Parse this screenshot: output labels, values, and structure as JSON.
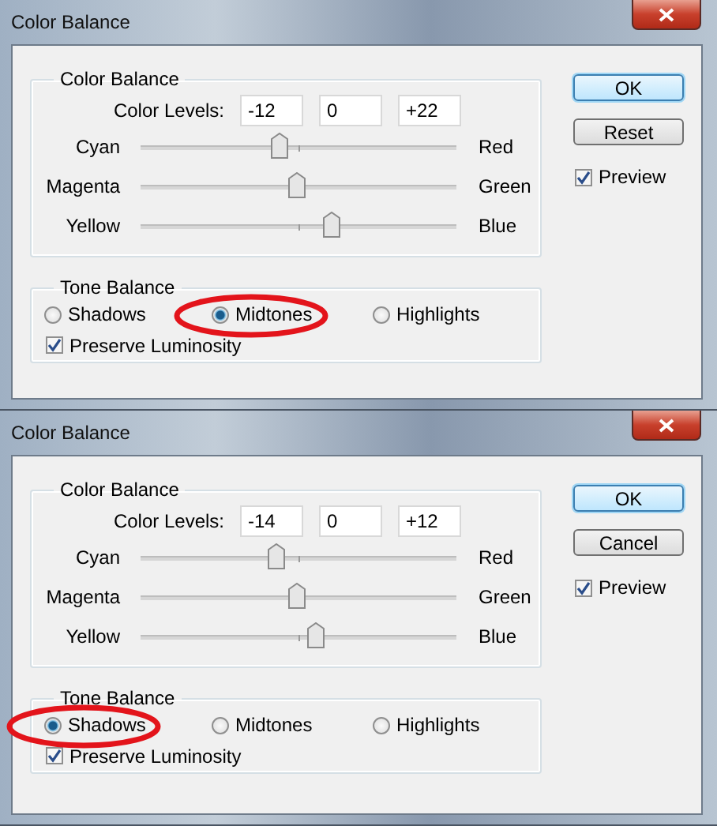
{
  "dialogs": [
    {
      "title": "Color Balance",
      "color_balance": {
        "heading": "Color Balance",
        "levels_label": "Color Levels:",
        "levels": [
          "-12",
          "0",
          "+22"
        ],
        "sliders": [
          {
            "left": "Cyan",
            "right": "Red",
            "level": 0.44
          },
          {
            "left": "Magenta",
            "right": "Green",
            "level": 0.495
          },
          {
            "left": "Yellow",
            "right": "Blue",
            "level": 0.605
          }
        ]
      },
      "tone_balance": {
        "heading": "Tone Balance",
        "options": [
          {
            "label": "Shadows",
            "selected": false,
            "circled": false
          },
          {
            "label": "Midtones",
            "selected": true,
            "circled": true
          },
          {
            "label": "Highlights",
            "selected": false,
            "circled": false
          }
        ],
        "preserve": {
          "label": "Preserve Luminosity",
          "checked": true
        }
      },
      "buttons": [
        {
          "label": "OK",
          "default": true
        },
        {
          "label": "Reset",
          "default": false
        }
      ],
      "preview": {
        "label": "Preview",
        "checked": true
      }
    },
    {
      "title": "Color Balance",
      "color_balance": {
        "heading": "Color Balance",
        "levels_label": "Color Levels:",
        "levels": [
          "-14",
          "0",
          "+12"
        ],
        "sliders": [
          {
            "left": "Cyan",
            "right": "Red",
            "level": 0.43
          },
          {
            "left": "Magenta",
            "right": "Green",
            "level": 0.495
          },
          {
            "left": "Yellow",
            "right": "Blue",
            "level": 0.555
          }
        ]
      },
      "tone_balance": {
        "heading": "Tone Balance",
        "options": [
          {
            "label": "Shadows",
            "selected": true,
            "circled": true
          },
          {
            "label": "Midtones",
            "selected": false,
            "circled": false
          },
          {
            "label": "Highlights",
            "selected": false,
            "circled": false
          }
        ],
        "preserve": {
          "label": "Preserve Luminosity",
          "checked": true
        }
      },
      "buttons": [
        {
          "label": "OK",
          "default": true
        },
        {
          "label": "Cancel",
          "default": false
        }
      ],
      "preview": {
        "label": "Preview",
        "checked": true
      }
    }
  ]
}
